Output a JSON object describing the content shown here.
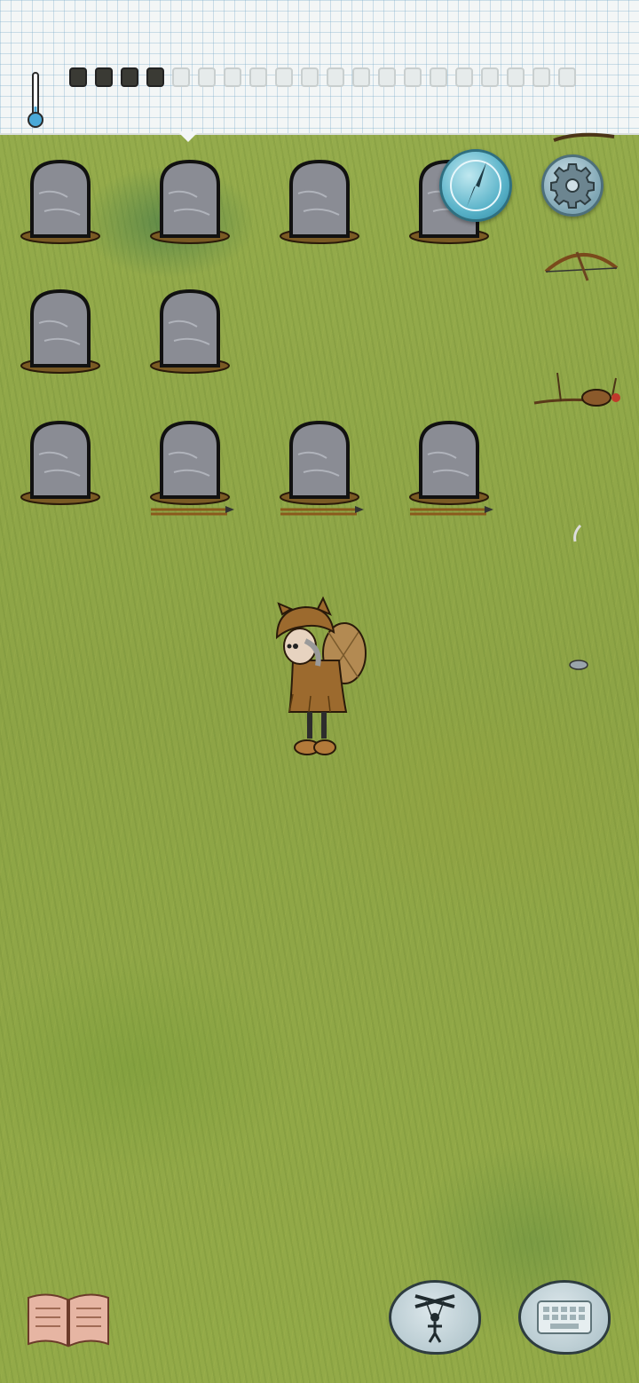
{
  "game": {
    "colors": {
      "grass": "#8da446",
      "paper": "#f3f6f6",
      "tombstone": "#8a8c94",
      "compass": "#5ab3c9",
      "hud_bubble": "#a9bfc6"
    },
    "food_meter": {
      "filled_slots": 4,
      "total_slots": 20
    },
    "temperature": {
      "icon": "thermometer-icon",
      "level": 0.25
    },
    "hud": {
      "compass": "compass-icon",
      "settings": "gear-icon",
      "recipe_book": "book-icon",
      "emote": "puppet-icon",
      "chat": "keyboard-icon"
    },
    "world_objects": [
      "bow-and-arrow",
      "dead-rabbit",
      "arrows",
      "flint-chip",
      "feather"
    ]
  }
}
